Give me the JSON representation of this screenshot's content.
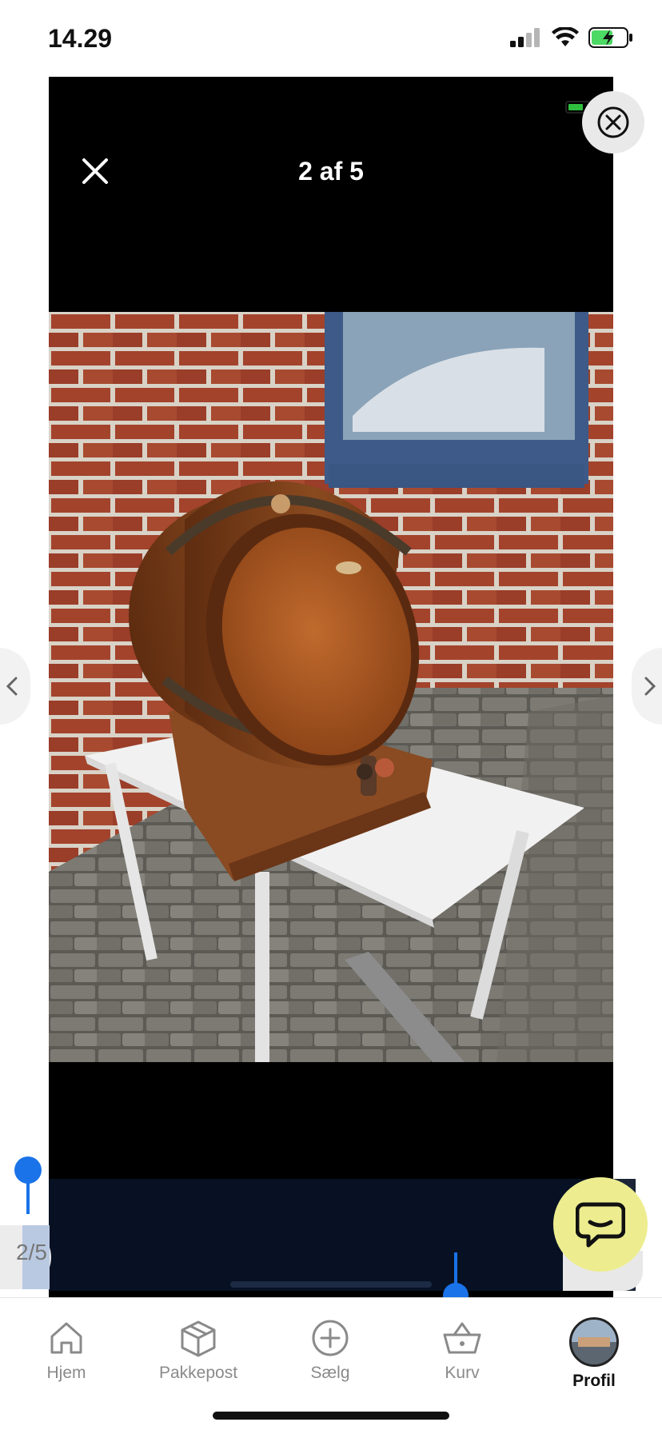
{
  "status_bar": {
    "time": "14.29"
  },
  "viewer": {
    "counter": "2 af 5"
  },
  "paginator": {
    "label": "2/5"
  },
  "tabs": [
    {
      "label": "Hjem",
      "icon": "home-icon"
    },
    {
      "label": "Pakkepost",
      "icon": "package-icon"
    },
    {
      "label": "Sælg",
      "icon": "plus-circle-icon"
    },
    {
      "label": "Kurv",
      "icon": "basket-icon"
    },
    {
      "label": "Profil",
      "icon": "avatar"
    }
  ],
  "colors": {
    "accent_blue": "#1a73e8",
    "chat_fab": "#eded8f",
    "battery_green": "#4cd964"
  }
}
